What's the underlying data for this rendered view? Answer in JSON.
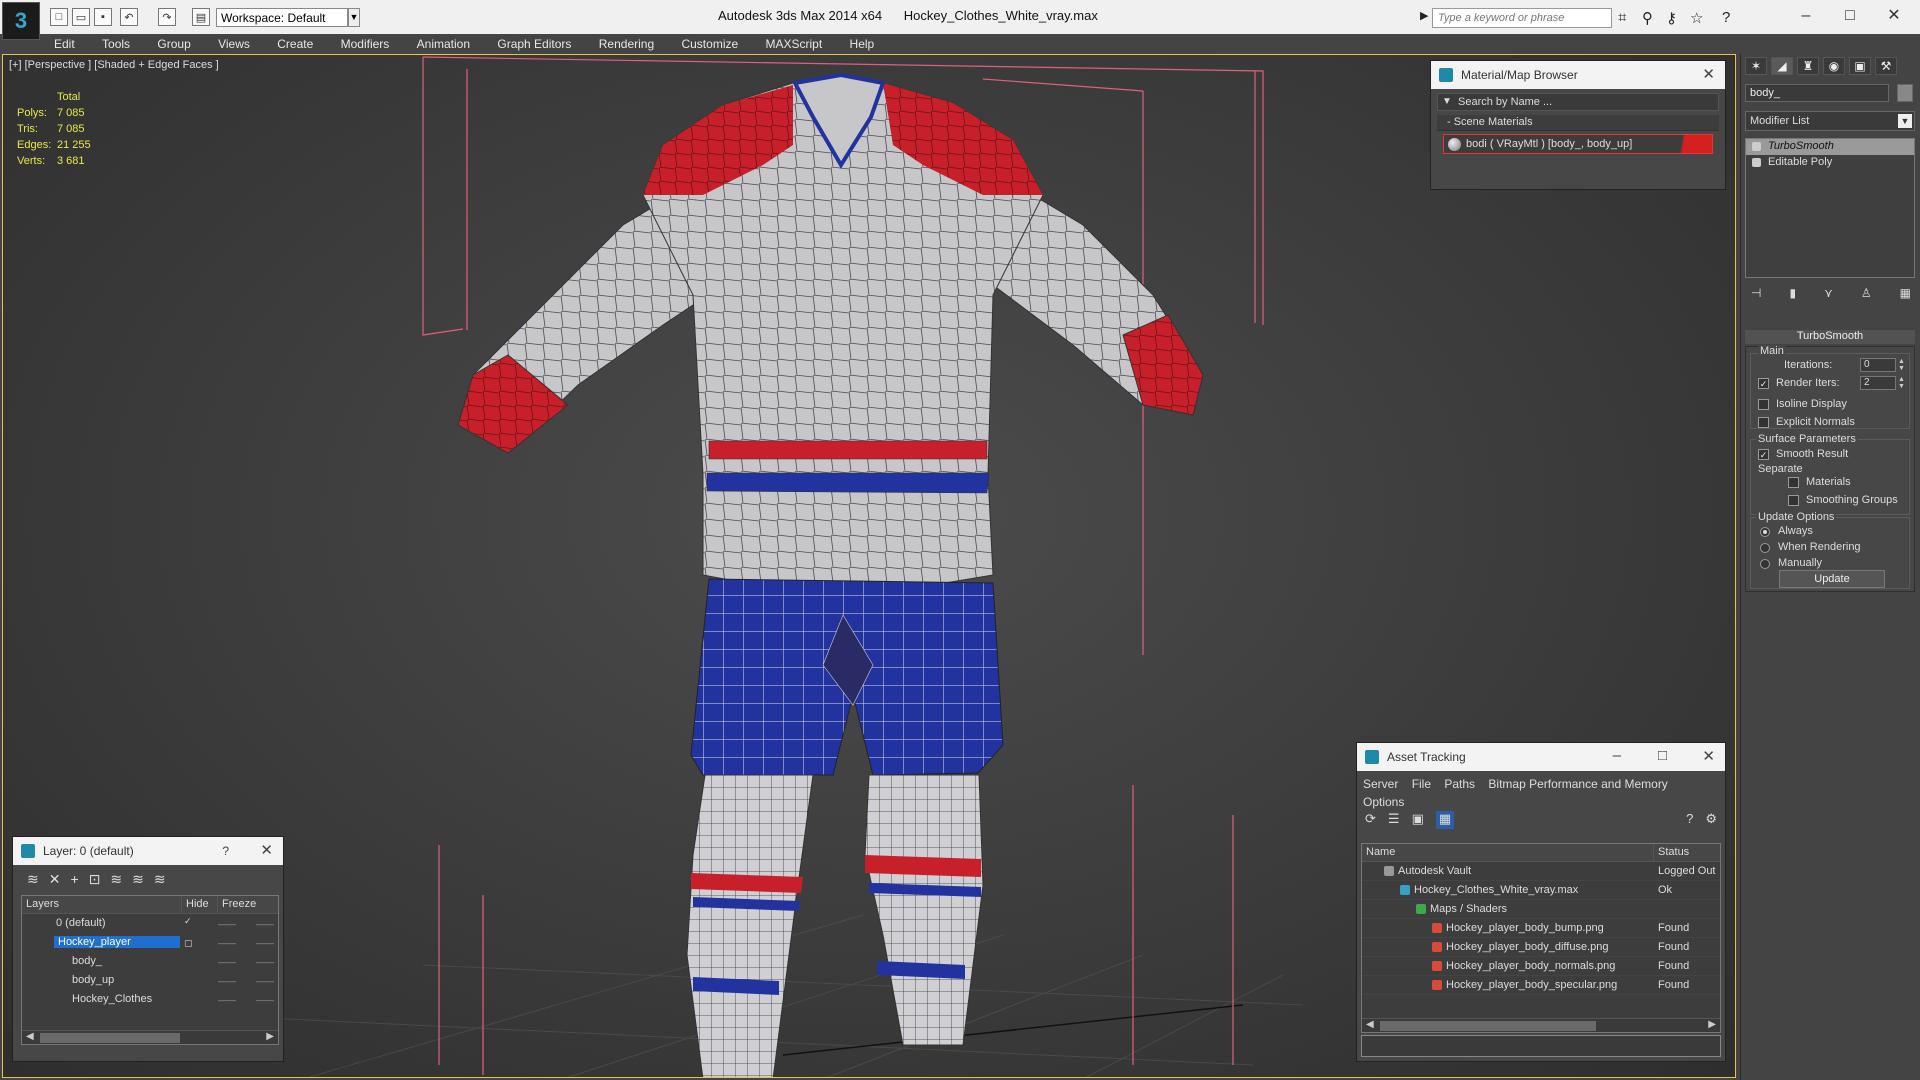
{
  "window": {
    "app_title": "Autodesk 3ds Max  2014 x64",
    "file_title": "Hockey_Clothes_White_vray.max",
    "workspace": "Workspace: Default",
    "search_placeholder": "Type a keyword or phrase"
  },
  "menu": [
    "Edit",
    "Tools",
    "Group",
    "Views",
    "Create",
    "Modifiers",
    "Animation",
    "Graph Editors",
    "Rendering",
    "Customize",
    "MAXScript",
    "Help"
  ],
  "viewport": {
    "label": "[+] [Perspective ] [Shaded + Edged Faces ]",
    "stats_header": "Total",
    "stats": [
      {
        "k": "Polys:",
        "v": "7 085"
      },
      {
        "k": "Tris:",
        "v": "7 085"
      },
      {
        "k": "Edges:",
        "v": "21 255"
      },
      {
        "k": "Verts:",
        "v": "3 681"
      }
    ]
  },
  "material_browser": {
    "title": "Material/Map Browser",
    "search": "Search by Name ...",
    "group": "- Scene Materials",
    "item": "bodi  ( VRayMtl ) [body_, body_up]"
  },
  "command_panel": {
    "object_name": "body_",
    "modifier_list": "Modifier List",
    "stack": [
      "TurboSmooth",
      "Editable Poly"
    ],
    "rollout_title": "TurboSmooth",
    "main_label": "Main",
    "iterations_label": "Iterations:",
    "iterations_value": "0",
    "render_iters_label": "Render Iters:",
    "render_iters_value": "2",
    "isoline": "Isoline Display",
    "explicit": "Explicit Normals",
    "surface_label": "Surface Parameters",
    "smooth_result": "Smooth Result",
    "separate_label": "Separate",
    "materials": "Materials",
    "smoothing_groups": "Smoothing Groups",
    "update_options": "Update Options",
    "always": "Always",
    "when_rendering": "When Rendering",
    "manually": "Manually",
    "update_button": "Update"
  },
  "layer_panel": {
    "title": "Layer: 0 (default)",
    "help": "?",
    "columns": [
      "Layers",
      "Hide",
      "Freeze"
    ],
    "rows": [
      "0 (default)",
      "Hockey_player",
      "body_",
      "body_up",
      "Hockey_Clothes"
    ]
  },
  "asset_panel": {
    "title": "Asset Tracking",
    "menu": [
      "Server",
      "File",
      "Paths",
      "Bitmap Performance and Memory",
      "Options"
    ],
    "columns": [
      "Name",
      "Status"
    ],
    "rows": [
      {
        "name": "Autodesk Vault",
        "status": "Logged Out"
      },
      {
        "name": "Hockey_Clothes_White_vray.max",
        "status": "Ok"
      },
      {
        "name": "Maps / Shaders",
        "status": ""
      },
      {
        "name": "Hockey_player_body_bump.png",
        "status": "Found"
      },
      {
        "name": "Hockey_player_body_diffuse.png",
        "status": "Found"
      },
      {
        "name": "Hockey_player_body_normals.png",
        "status": "Found"
      },
      {
        "name": "Hockey_player_body_specular.png",
        "status": "Found"
      }
    ]
  },
  "colors": {
    "jersey_red": "#c8202a",
    "jersey_blue": "#2233a0",
    "jersey_white": "#c9c9cc",
    "viewport_border": "#e9c24a",
    "selection_blue": "#1e6fce"
  }
}
